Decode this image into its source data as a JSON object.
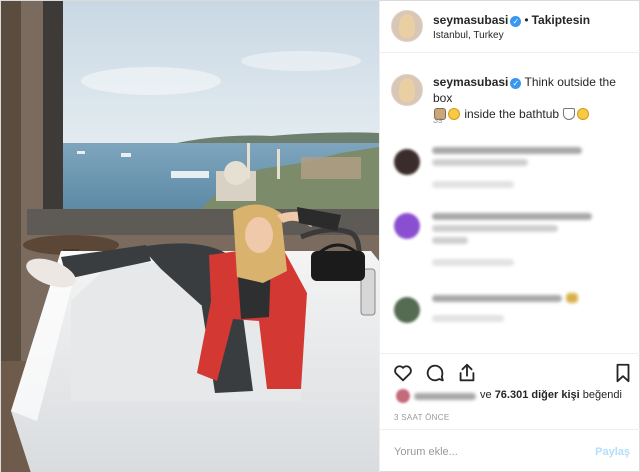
{
  "header": {
    "username": "seymasubasi",
    "verified_glyph": "✓",
    "separator": "•",
    "follow_status": "Takiptesin",
    "location": "Istanbul, Turkey"
  },
  "caption": {
    "username": "seymasubasi",
    "text_part1": "Think outside the box",
    "text_part2": "inside the bathtub",
    "time": "3s"
  },
  "likes": {
    "count_text": "76.301 diğer kişi",
    "prefix": "ve",
    "suffix": "beğendi"
  },
  "timestamp": "3 SAAT ÖNCE",
  "comment_box": {
    "placeholder": "Yorum ekle...",
    "post_label": "Paylaş"
  },
  "icons": [
    "heart-icon",
    "comment-icon",
    "share-icon",
    "bookmark-icon",
    "verified-icon"
  ],
  "colors": {
    "accent_blue": "#3897f0",
    "post_disabled": "#b2dffc",
    "muted_text": "#999999",
    "border": "#efefef"
  }
}
